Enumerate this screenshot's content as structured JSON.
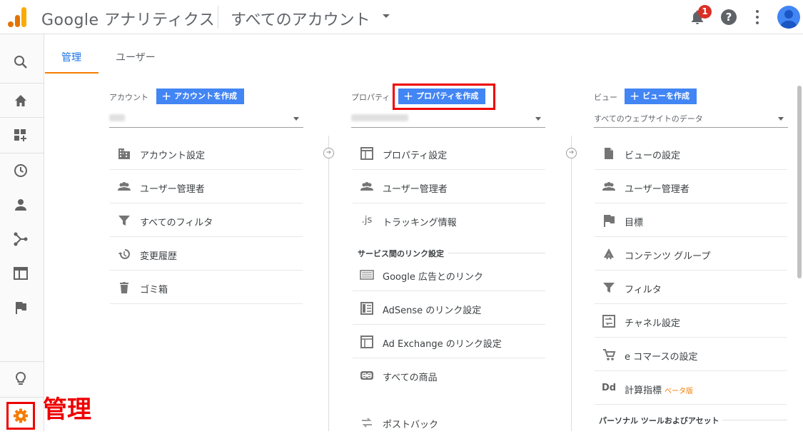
{
  "header": {
    "brand": "Google アナリティクス",
    "account_selector": "すべてのアカウント",
    "notification_count": "1",
    "help_label": "?"
  },
  "tabs": [
    {
      "label": "管理",
      "active": true
    },
    {
      "label": "ユーザー",
      "active": false
    }
  ],
  "annotation": {
    "label": "管理"
  },
  "columns": {
    "account": {
      "label": "アカウント",
      "create_button": "アカウントを作成",
      "items": [
        {
          "label": "アカウント設定",
          "icon": "building-icon"
        },
        {
          "label": "ユーザー管理者",
          "icon": "users-icon"
        },
        {
          "label": "すべてのフィルタ",
          "icon": "filter-icon"
        },
        {
          "label": "変更履歴",
          "icon": "history-icon"
        },
        {
          "label": "ゴミ箱",
          "icon": "trash-icon"
        }
      ]
    },
    "property": {
      "label": "プロパティ",
      "create_button": "プロパティを作成",
      "items": [
        {
          "label": "プロパティ設定",
          "icon": "window-icon"
        },
        {
          "label": "ユーザー管理者",
          "icon": "users-icon"
        },
        {
          "label": "トラッキング情報",
          "icon": "js-icon",
          "icon_text": ".js"
        }
      ],
      "section": "サービス間のリンク設定",
      "link_items": [
        {
          "label": "Google 広告とのリンク",
          "icon": "ads-icon"
        },
        {
          "label": "AdSense のリンク設定",
          "icon": "adsense-icon"
        },
        {
          "label": "Ad Exchange のリンク設定",
          "icon": "adexchange-icon"
        },
        {
          "label": "すべての商品",
          "icon": "link-icon"
        },
        {
          "label": "ポストバック",
          "icon": "postback-icon"
        }
      ]
    },
    "view": {
      "label": "ビュー",
      "create_button": "ビューを作成",
      "selector": "すべてのウェブサイトのデータ",
      "items": [
        {
          "label": "ビューの設定",
          "icon": "document-icon"
        },
        {
          "label": "ユーザー管理者",
          "icon": "users-icon"
        },
        {
          "label": "目標",
          "icon": "flag-icon"
        },
        {
          "label": "コンテンツ グループ",
          "icon": "content-group-icon"
        },
        {
          "label": "フィルタ",
          "icon": "filter-icon"
        },
        {
          "label": "チャネル設定",
          "icon": "channel-icon"
        },
        {
          "label": "e コマースの設定",
          "icon": "cart-icon"
        },
        {
          "label": "計算指標",
          "icon": "dd-icon",
          "icon_text": "Dd",
          "badge": "ベータ版"
        }
      ],
      "section": "パーソナル ツールおよびアセット"
    }
  }
}
